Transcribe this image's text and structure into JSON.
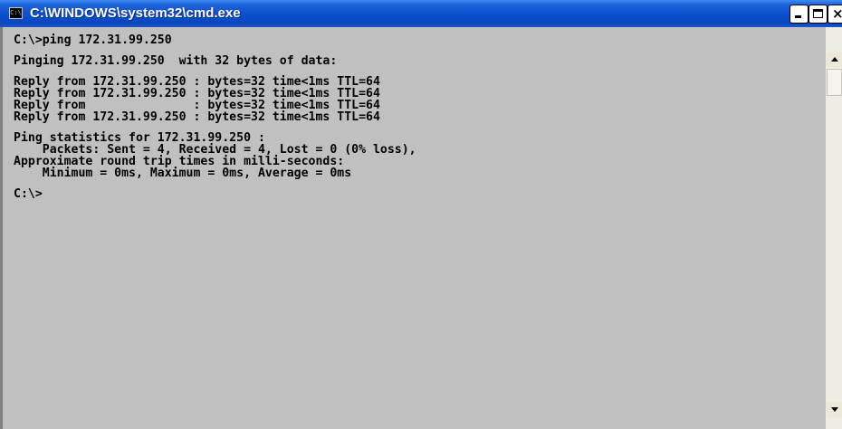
{
  "window": {
    "title": "C:\\WINDOWS\\system32\\cmd.exe",
    "icon": "console-icon",
    "icon_text": "C:\\",
    "buttons": {
      "minimize": "minimize-icon",
      "maximize": "maximize-icon",
      "close": "close-icon",
      "close_glyph": "×"
    }
  },
  "console": {
    "background": "#c0c0c0",
    "foreground": "#000000",
    "lines": [
      "C:\\>ping 172.31.99.250",
      "",
      "Pinging 172.31.99.250  with 32 bytes of data:",
      "",
      "Reply from 172.31.99.250 : bytes=32 time<1ms TTL=64",
      "Reply from 172.31.99.250 : bytes=32 time<1ms TTL=64",
      "Reply from               : bytes=32 time<1ms TTL=64",
      "Reply from 172.31.99.250 : bytes=32 time<1ms TTL=64",
      "",
      "Ping statistics for 172.31.99.250 :",
      "    Packets: Sent = 4, Received = 4, Lost = 0 (0% loss),",
      "Approximate round trip times in milli-seconds:",
      "    Minimum = 0ms, Maximum = 0ms, Average = 0ms",
      "",
      "C:\\>"
    ]
  },
  "colors": {
    "titlebar": "#0a4fd0",
    "title_text": "#ffffff",
    "scrollbar_track": "#eeede5"
  }
}
